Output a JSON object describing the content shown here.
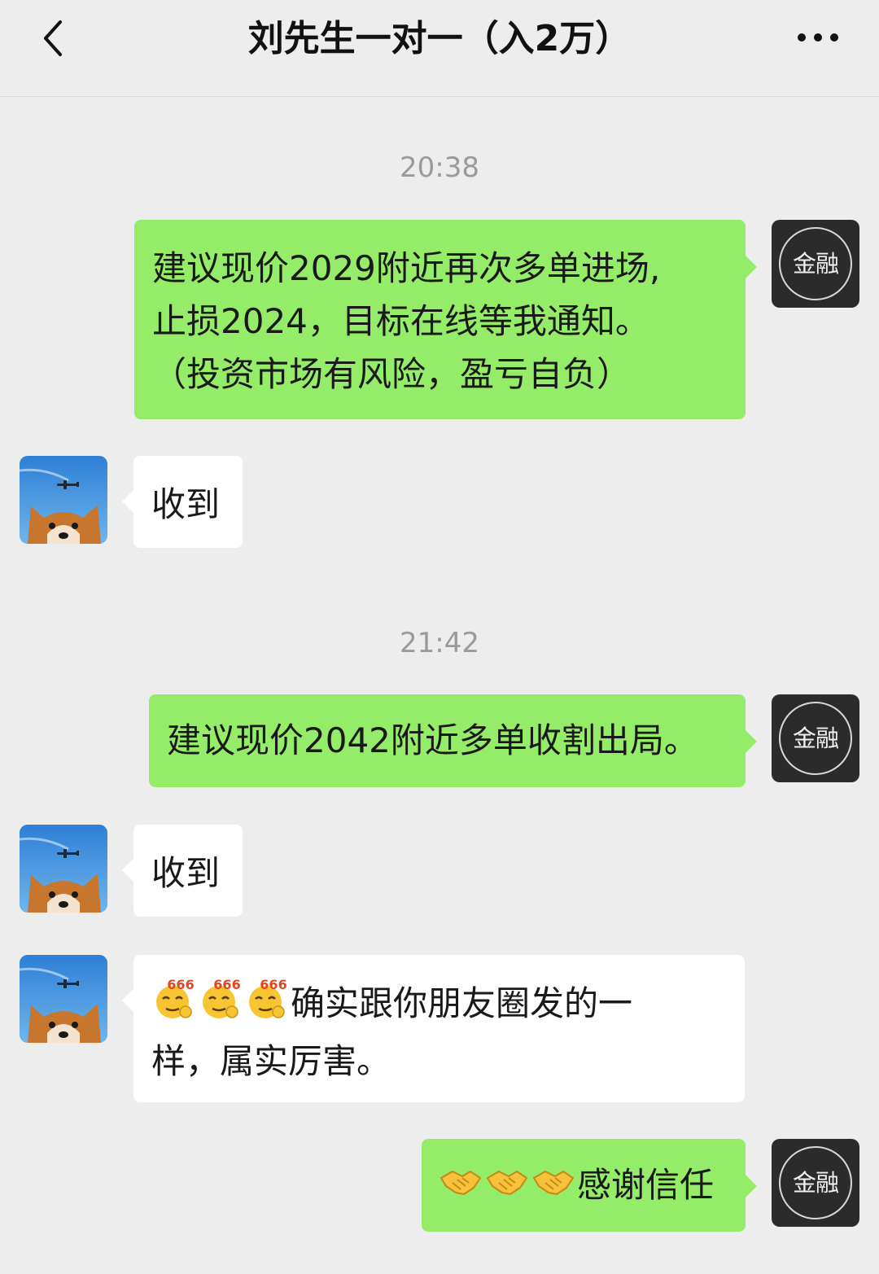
{
  "header": {
    "title": "刘先生一对一（入2万）"
  },
  "self_avatar_label": "金融",
  "messages": [
    {
      "time": "20:38"
    },
    {
      "from": "self",
      "text": "建议现价2029附近再次多单进场，止损2024，目标在线等我通知。（投资市场有风险，盈亏自负）",
      "lines": [
        "建议现价2029附近再次多单进场,",
        "止损2024，目标在线等我通知。",
        "（投资市场有风险，盈亏自负）"
      ]
    },
    {
      "from": "other",
      "text": "收到"
    },
    {
      "time": "21:42"
    },
    {
      "from": "self",
      "text": "建议现价2042附近多单收割出局。"
    },
    {
      "from": "other",
      "text": "收到"
    },
    {
      "from": "other",
      "emoji": [
        "666-emoji",
        "666-emoji",
        "666-emoji"
      ],
      "emoji_label": "666",
      "lines": [
        "确实跟你朋友圈发的一",
        "样，属实厉害。"
      ]
    },
    {
      "from": "self",
      "emoji": [
        "handshake-emoji",
        "handshake-emoji",
        "handshake-emoji"
      ],
      "text": "感谢信任"
    }
  ],
  "colors": {
    "background": "#ededed",
    "outgoing_bubble": "#95ec69",
    "incoming_bubble": "#ffffff",
    "timestamp": "#9a9a9a"
  },
  "icons": {
    "back": "chevron-left-icon",
    "more": "more-dots-icon"
  }
}
